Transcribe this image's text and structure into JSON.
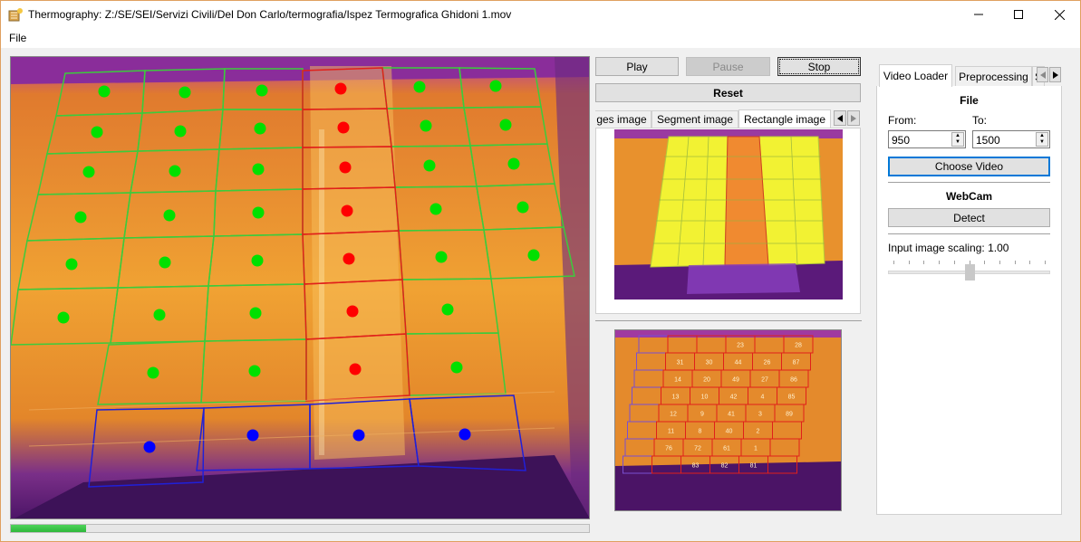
{
  "window": {
    "title": "Thermography: Z:/SE/SEI/Servizi Civili/Del Don Carlo/termografia/Ispez Termografica Ghidoni 1.mov"
  },
  "menu": {
    "file": "File"
  },
  "controls": {
    "play": "Play",
    "pause": "Pause",
    "stop": "Stop",
    "reset": "Reset"
  },
  "image_tabs": [
    "ges image",
    "Segment image",
    "Rectangle image"
  ],
  "image_tabs_active": "Rectangle image",
  "video_progress": 0.13,
  "side_tabs": [
    "Video Loader",
    "Preprocessing",
    "S"
  ],
  "side_tabs_active": "Video Loader",
  "loader": {
    "file_title": "File",
    "from_label": "From:",
    "to_label": "To:",
    "from_value": "950",
    "to_value": "1500",
    "choose_video": "Choose Video",
    "webcam_title": "WebCam",
    "detect": "Detect",
    "scaling_label": "Input image scaling: 1.00",
    "scaling_value": 1.0
  },
  "colors": {
    "ok_marker": "#00e000",
    "fault_marker": "#ff0000",
    "excluded_marker": "#0000ff",
    "accent": "#0078d7"
  },
  "panel_numbers": [
    [
      "",
      "",
      "",
      "23",
      "",
      "28"
    ],
    [
      "",
      "31",
      "30",
      "44",
      "26",
      "87"
    ],
    [
      "",
      "14",
      "20",
      "49",
      "27",
      "86"
    ],
    [
      "",
      "13",
      "10",
      "42",
      "4",
      "85"
    ],
    [
      "",
      "12",
      "9",
      "41",
      "3",
      "89"
    ],
    [
      "",
      "11",
      "8",
      "40",
      "2",
      ""
    ],
    [
      "",
      "76",
      "72",
      "61",
      "1",
      ""
    ],
    [
      "",
      "",
      "83",
      "82",
      "81",
      ""
    ]
  ]
}
